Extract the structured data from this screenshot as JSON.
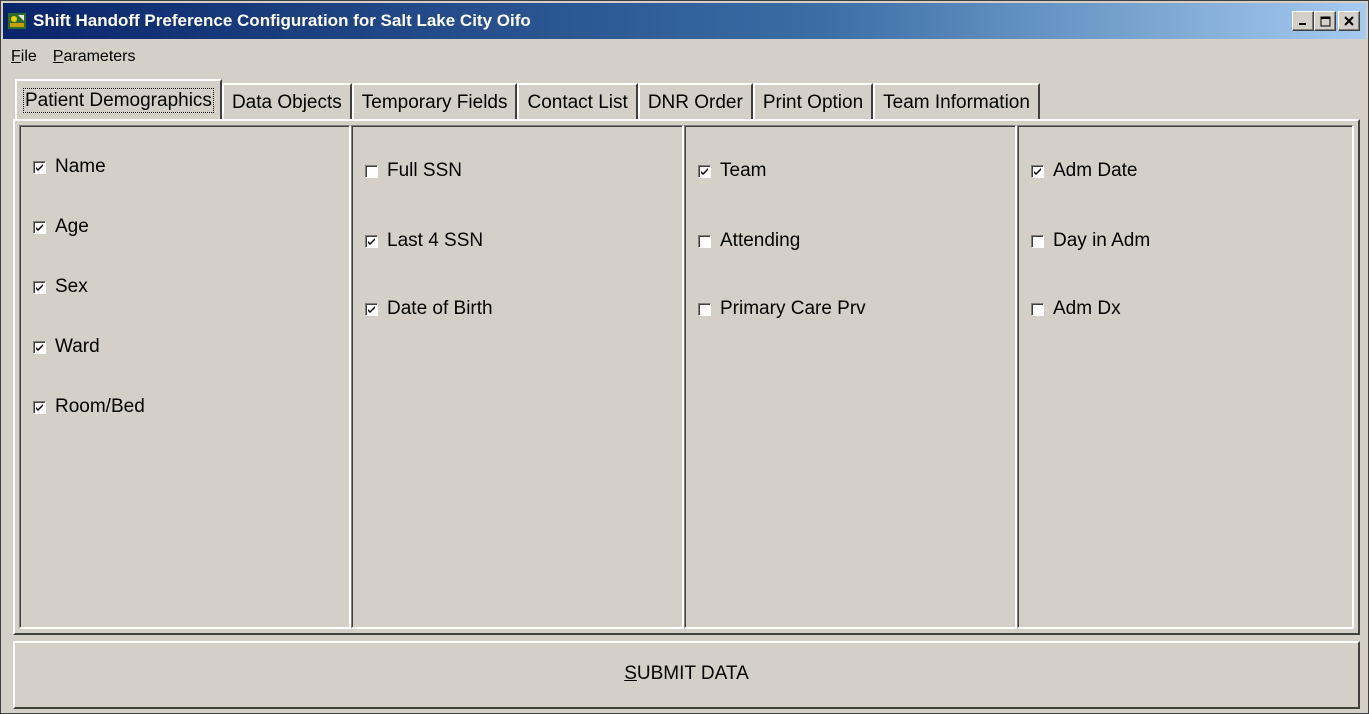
{
  "window": {
    "title": "Shift Handoff Preference Configuration for Salt Lake City Oifo",
    "icon": "application-icon",
    "controls": [
      "minimize-icon",
      "maximize-icon",
      "close-icon"
    ]
  },
  "menu": [
    {
      "accel": "F",
      "rest": "ile"
    },
    {
      "accel": "P",
      "rest": "arameters"
    }
  ],
  "tabs": [
    {
      "label": "Patient Demographics",
      "active": true
    },
    {
      "label": "Data Objects",
      "active": false
    },
    {
      "label": "Temporary Fields",
      "active": false
    },
    {
      "label": "Contact List",
      "active": false
    },
    {
      "label": "DNR Order",
      "active": false
    },
    {
      "label": "Print Option",
      "active": false
    },
    {
      "label": "Team Information",
      "active": false
    }
  ],
  "columns": [
    {
      "items": [
        {
          "label": "Name",
          "checked": true
        },
        {
          "label": "Age",
          "checked": true
        },
        {
          "label": "Sex",
          "checked": true
        },
        {
          "label": "Ward",
          "checked": true
        },
        {
          "label": "Room/Bed",
          "checked": true
        }
      ]
    },
    {
      "items": [
        {
          "label": "Full SSN",
          "checked": false
        },
        {
          "label": "Last 4 SSN",
          "checked": true
        },
        {
          "label": "Date of Birth",
          "checked": true
        }
      ]
    },
    {
      "items": [
        {
          "label": "Team",
          "checked": true
        },
        {
          "label": "Attending",
          "checked": false
        },
        {
          "label": "Primary Care Prv",
          "checked": false
        }
      ]
    },
    {
      "items": [
        {
          "label": "Adm Date",
          "checked": true
        },
        {
          "label": "Day in Adm",
          "checked": false
        },
        {
          "label": "Adm Dx",
          "checked": false
        }
      ]
    }
  ],
  "submit": {
    "accel": "S",
    "rest": "UBMIT DATA"
  }
}
